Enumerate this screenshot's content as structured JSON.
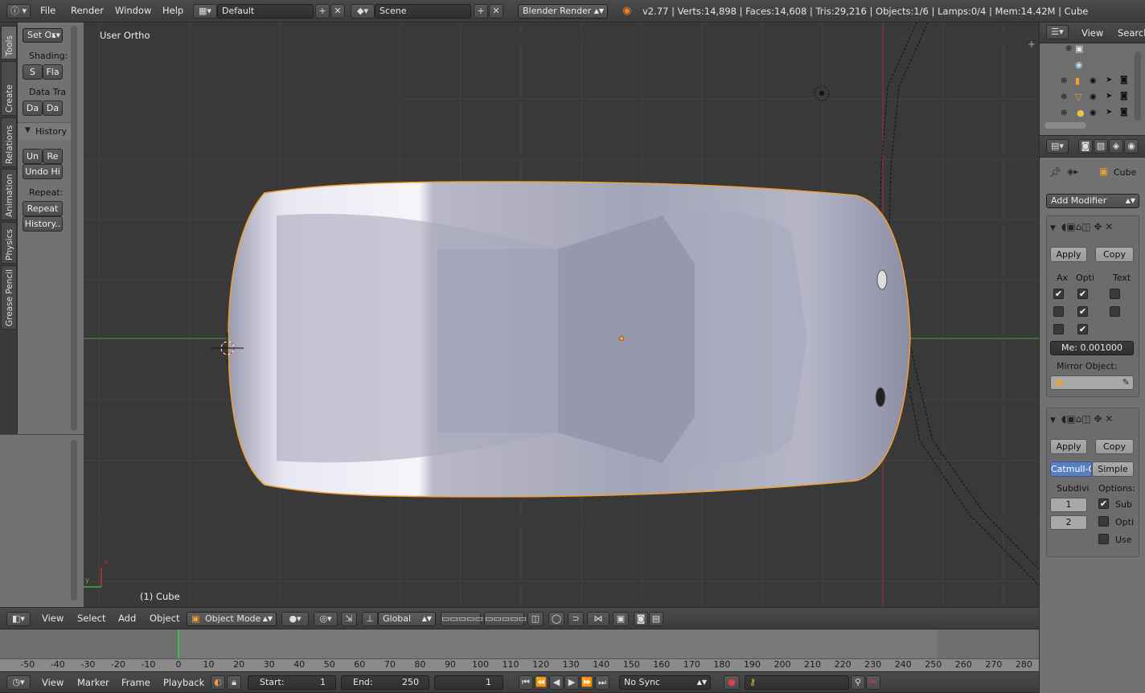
{
  "top_bar": {
    "menus": [
      "File",
      "Render",
      "Window",
      "Help"
    ],
    "screen_layout": "Default",
    "scene": "Scene",
    "render_engine": "Blender Render",
    "stats": "v2.77 | Verts:14,898 | Faces:14,608 | Tris:29,216 | Objects:1/6 | Lamps:0/4 | Mem:14.42M | Cube"
  },
  "tool_shelf": {
    "tabs": [
      "Tools",
      "Create",
      "Relations",
      "Animation",
      "Physics",
      "Grease Pencil"
    ],
    "set_origin": "Set Or",
    "shading_label": "Shading:",
    "shading_smooth": "S",
    "shading_flat": "Fla",
    "data_transfer_label": "Data Tra",
    "data_btn_1": "Da",
    "data_btn_2": "Da",
    "history_header": "History",
    "undo": "Un",
    "redo": "Re",
    "undo_history": "Undo Hi",
    "repeat_label": "Repeat:",
    "repeat": "Repeat",
    "repeat_history": "History.."
  },
  "viewport": {
    "view_name": "User Ortho",
    "object_label": "(1) Cube",
    "axis_x": "x",
    "axis_y": "y"
  },
  "view3d_header": {
    "menus": [
      "View",
      "Select",
      "Add",
      "Object"
    ],
    "mode": "Object Mode",
    "orientation": "Global"
  },
  "outliner": {
    "view": "View",
    "search": "Search"
  },
  "properties": {
    "object_name": "Cube",
    "add_modifier": "Add Modifier",
    "mirror": {
      "apply": "Apply",
      "copy": "Copy",
      "col_axis": "Ax",
      "col_options": "Opti",
      "col_textures": "Text",
      "checks": [
        [
          true,
          true,
          false
        ],
        [
          false,
          true,
          false
        ],
        [
          false,
          true,
          null
        ]
      ],
      "merge_value": "Me: 0.001000",
      "mirror_object_label": "Mirror Object:"
    },
    "subsurf": {
      "apply": "Apply",
      "copy": "Copy",
      "catmull": "Catmull-C",
      "simple": "Simple",
      "subdiv_label": "Subdivi",
      "options_label": "Options:",
      "view_level": "1",
      "render_level": "2",
      "opt_sub": "Sub",
      "opt_opti": "Opti",
      "opt_use": "Use",
      "opt_checks": [
        true,
        false,
        false
      ]
    }
  },
  "timeline": {
    "ticks": [
      "-50",
      "-40",
      "-30",
      "-20",
      "-10",
      "0",
      "10",
      "20",
      "30",
      "40",
      "50",
      "60",
      "70",
      "80",
      "90",
      "100",
      "110",
      "120",
      "130",
      "140",
      "150",
      "160",
      "170",
      "180",
      "190",
      "200",
      "210",
      "220",
      "230",
      "240",
      "250",
      "260",
      "270",
      "280"
    ],
    "menus": [
      "View",
      "Marker",
      "Frame",
      "Playback"
    ],
    "start_label": "Start:",
    "start_value": "1",
    "end_label": "End:",
    "end_value": "250",
    "current_frame": "1",
    "sync": "No Sync"
  },
  "colors": {
    "selection_outline": "#f0a030",
    "x_axis": "#b03030",
    "y_axis": "#40b040",
    "highlight": "#5680c2"
  }
}
